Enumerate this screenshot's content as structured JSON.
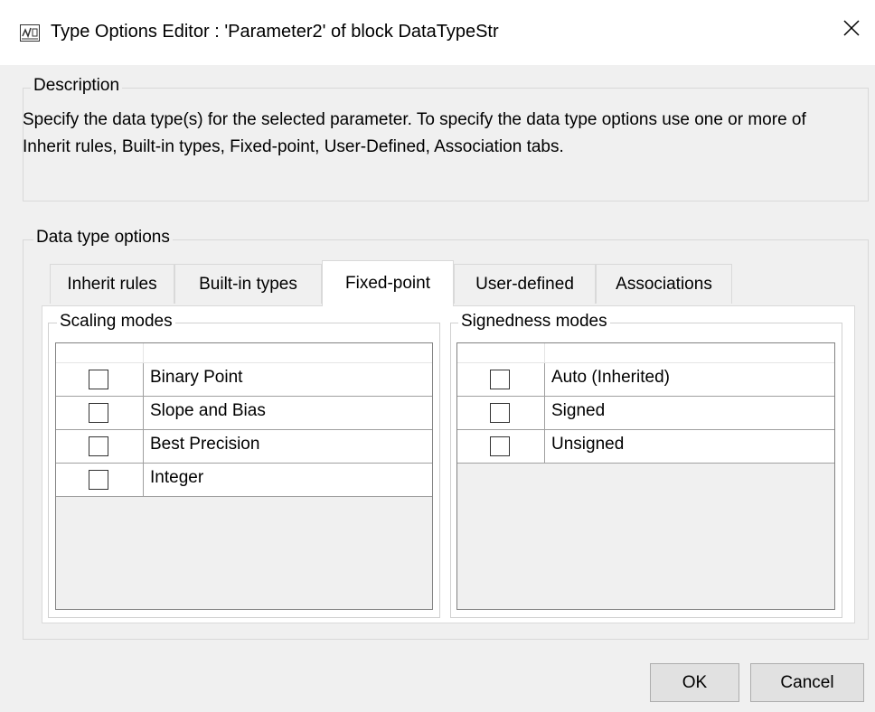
{
  "window": {
    "title": "Type Options Editor : 'Parameter2' of block DataTypeStr",
    "icon": "simulink-app-icon",
    "close_icon": "close-icon"
  },
  "description": {
    "legend": "Description",
    "text": "Specify the data type(s) for the selected parameter. To specify the data type options use one or more of Inherit rules, Built-in types, Fixed-point, User-Defined, Association tabs."
  },
  "options": {
    "legend": "Data type options",
    "tabs": [
      {
        "label": "Inherit rules",
        "active": false
      },
      {
        "label": "Built-in types",
        "active": false
      },
      {
        "label": "Fixed-point",
        "active": true
      },
      {
        "label": "User-defined",
        "active": false
      },
      {
        "label": "Associations",
        "active": false
      }
    ]
  },
  "scaling": {
    "legend": "Scaling modes",
    "rows": [
      {
        "label": "Binary Point",
        "checked": false
      },
      {
        "label": "Slope and Bias",
        "checked": false
      },
      {
        "label": "Best Precision",
        "checked": false
      },
      {
        "label": "Integer",
        "checked": false
      }
    ]
  },
  "signedness": {
    "legend": "Signedness modes",
    "rows": [
      {
        "label": "Auto (Inherited)",
        "checked": false
      },
      {
        "label": "Signed",
        "checked": false
      },
      {
        "label": "Unsigned",
        "checked": false
      }
    ]
  },
  "buttons": {
    "ok": "OK",
    "cancel": "Cancel"
  }
}
